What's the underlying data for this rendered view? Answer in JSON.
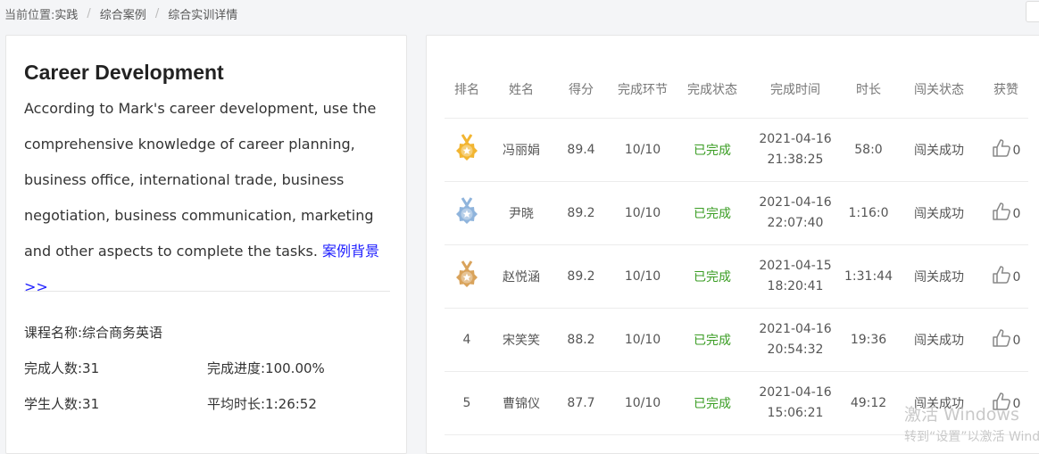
{
  "breadcrumb": {
    "prefix": "当前位置:",
    "items": [
      "实践",
      "综合案例",
      "综合实训详情"
    ],
    "separator": "/"
  },
  "case": {
    "title": "Career Development",
    "description": "According to Mark's career development, use the comprehensive knowledge of career planning, business office, international trade, business negotiation, business communication, marketing and other aspects to complete the tasks.",
    "background_link": "案例背景>>"
  },
  "info": {
    "course_name": "课程名称:综合商务英语",
    "completed_count": "完成人数:31",
    "progress": "完成进度:100.00%",
    "student_count": "学生人数:31",
    "avg_duration": "平均时长:1:26:52"
  },
  "table": {
    "headers": {
      "rank": "排名",
      "name": "姓名",
      "score": "得分",
      "steps": "完成环节",
      "status": "完成状态",
      "time": "完成时间",
      "duration": "时长",
      "level": "闯关状态",
      "likes": "获赞"
    },
    "rows": [
      {
        "rank": "1",
        "medal": "gold-medal-icon",
        "name": "冯丽娟",
        "score": "89.4",
        "steps": "10/10",
        "status": "已完成",
        "date": "2021-04-16",
        "clock": "21:38:25",
        "duration": "58:0",
        "level": "闯关成功",
        "likes": "0"
      },
      {
        "rank": "2",
        "medal": "silver-medal-icon",
        "name": "尹晓",
        "score": "89.2",
        "steps": "10/10",
        "status": "已完成",
        "date": "2021-04-16",
        "clock": "22:07:40",
        "duration": "1:16:0",
        "level": "闯关成功",
        "likes": "0"
      },
      {
        "rank": "3",
        "medal": "bronze-medal-icon",
        "name": "赵悦涵",
        "score": "89.2",
        "steps": "10/10",
        "status": "已完成",
        "date": "2021-04-15",
        "clock": "18:20:41",
        "duration": "1:31:44",
        "level": "闯关成功",
        "likes": "0"
      },
      {
        "rank": "4",
        "medal": "",
        "name": "宋笑笑",
        "score": "88.2",
        "steps": "10/10",
        "status": "已完成",
        "date": "2021-04-16",
        "clock": "20:54:32",
        "duration": "19:36",
        "level": "闯关成功",
        "likes": "0"
      },
      {
        "rank": "5",
        "medal": "",
        "name": "曹锦仪",
        "score": "87.7",
        "steps": "10/10",
        "status": "已完成",
        "date": "2021-04-16",
        "clock": "15:06:21",
        "duration": "49:12",
        "level": "闯关成功",
        "likes": "0"
      }
    ]
  },
  "colors": {
    "done_green": "#3a9d23",
    "link_blue": "#1e1eff",
    "gold": "#f2b531",
    "silver": "#8fb4dc",
    "bronze": "#d9a35b"
  },
  "watermark": {
    "line1": "激活 Windows",
    "line2": "转到“设置”以激活 Windows。"
  }
}
